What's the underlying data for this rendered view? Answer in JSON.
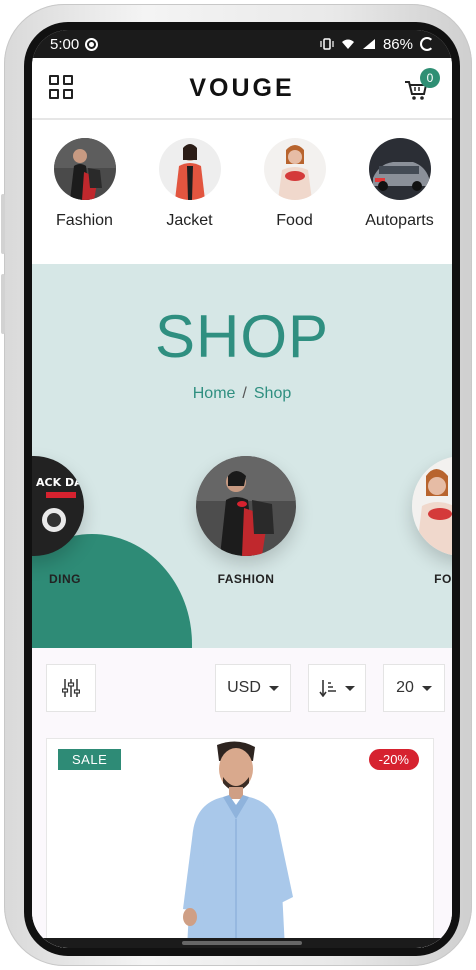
{
  "status_bar": {
    "time": "5:00",
    "battery": "86%"
  },
  "header": {
    "brand": "VOUGE",
    "cart_count": "0"
  },
  "categories": [
    {
      "label": "Fashion"
    },
    {
      "label": "Jacket"
    },
    {
      "label": "Food"
    },
    {
      "label": "Autoparts"
    }
  ],
  "banner": {
    "title": "SHOP",
    "breadcrumb": {
      "home": "Home",
      "separator": "/",
      "current": "Shop"
    },
    "carousel": [
      {
        "label": "DING",
        "promo_text": "ACK DAY"
      },
      {
        "label": "FASHION"
      },
      {
        "label": "FO"
      }
    ]
  },
  "filters": {
    "currency": "USD",
    "per_page": "20"
  },
  "product": {
    "sale_label": "SALE",
    "discount": "-20%"
  },
  "colors": {
    "accent": "#2e8b76",
    "banner_bg": "#d6e7e6",
    "sale": "#2e8b76",
    "discount": "#d6222f"
  }
}
